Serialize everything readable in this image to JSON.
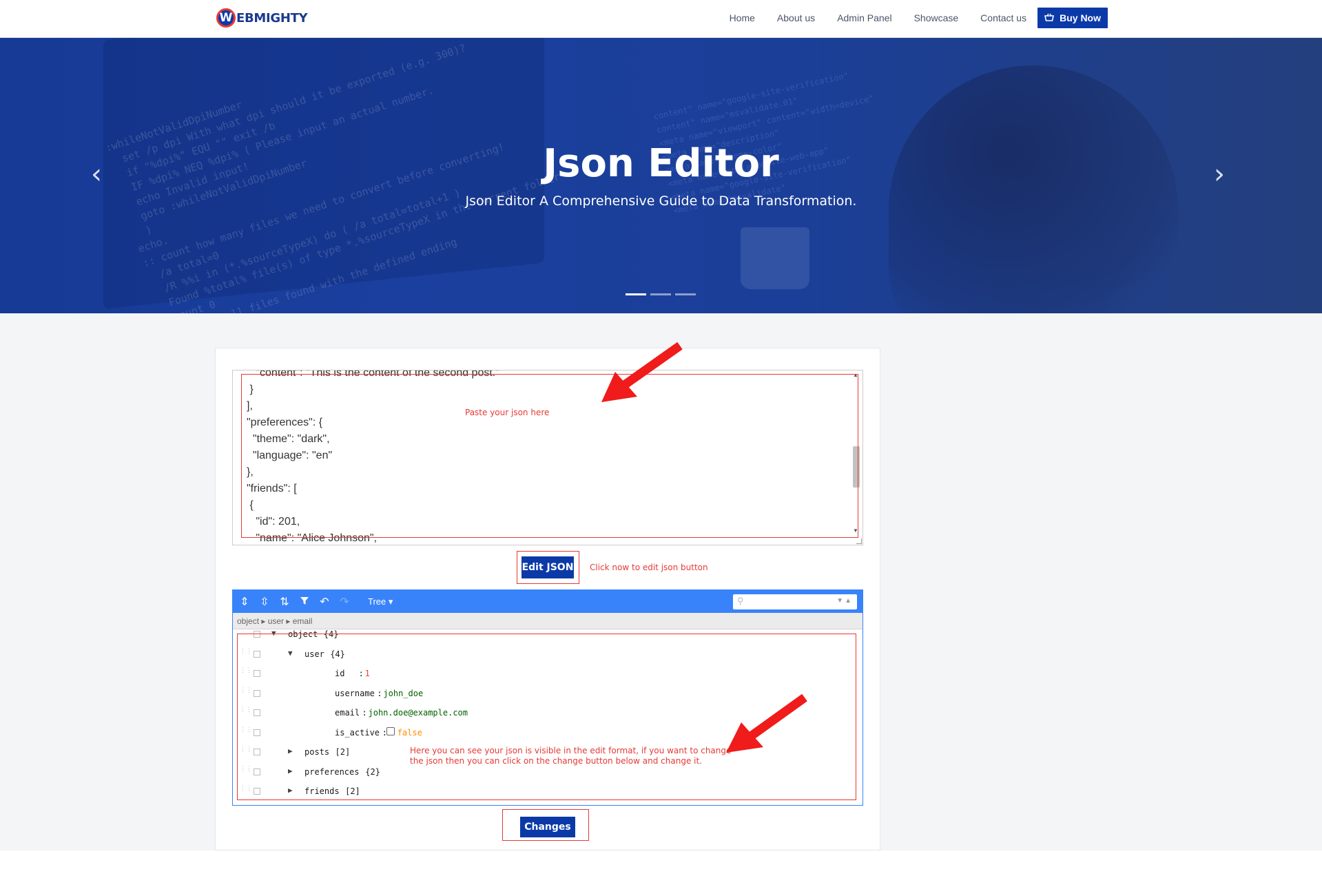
{
  "brand": {
    "logo_letter": "W",
    "logo_text": "EBMIGHTY"
  },
  "nav": {
    "items": [
      "Home",
      "About us",
      "Admin Panel",
      "Showcase",
      "Contact us"
    ],
    "buy_label": "Buy Now"
  },
  "hero": {
    "title": "Json Editor",
    "subtitle": "Json Editor A Comprehensive Guide to Data Transformation.",
    "prev_icon": "‹",
    "next_icon": "›",
    "slides": 3,
    "active_slide": 1
  },
  "textarea": {
    "lines": [
      "   \"content\": \"This is the content of the second post.\"",
      " }",
      "],",
      "\"preferences\": {",
      "  \"theme\": \"dark\",",
      "  \"language\": \"en\"",
      "},",
      "\"friends\": [",
      " {",
      "   \"id\": 201,",
      "   \"name\": \"Alice Johnson\","
    ]
  },
  "notes": {
    "paste": "Paste your json here",
    "click_edit": "Click now to edit json  button",
    "tree_note_1": "Here you can see your json is visible in the edit format, if you want to change",
    "tree_note_2": "the json then you can click on the change button below and change it."
  },
  "buttons": {
    "edit_json": "Edit JSON",
    "changes": "Changes"
  },
  "editor": {
    "mode_label": "Tree ▾",
    "navbar": "object ▸ user ▸ email",
    "rows": [
      {
        "indent": 0,
        "toggle": "▼",
        "field": "object",
        "count": "{4}",
        "kind": "node"
      },
      {
        "indent": 1,
        "toggle": "▼",
        "field": "user",
        "count": "{4}",
        "kind": "node"
      },
      {
        "indent": 2,
        "field": "id",
        "value": "1",
        "kind": "number"
      },
      {
        "indent": 2,
        "field": "username",
        "value": "john_doe",
        "kind": "string"
      },
      {
        "indent": 2,
        "field": "email",
        "value": "john.doe@example.com",
        "kind": "string"
      },
      {
        "indent": 2,
        "field": "is_active",
        "value": "false",
        "kind": "boolean"
      },
      {
        "indent": 1,
        "toggle": "▶",
        "field": "posts",
        "count": "[2]",
        "kind": "node"
      },
      {
        "indent": 1,
        "toggle": "▶",
        "field": "preferences",
        "count": "{2}",
        "kind": "node"
      },
      {
        "indent": 1,
        "toggle": "▶",
        "field": "friends",
        "count": "[2]",
        "kind": "node"
      }
    ]
  },
  "colors": {
    "brand_blue": "#0b3aa8",
    "editor_blue": "#3883fa",
    "annotation_red": "#e53935"
  }
}
